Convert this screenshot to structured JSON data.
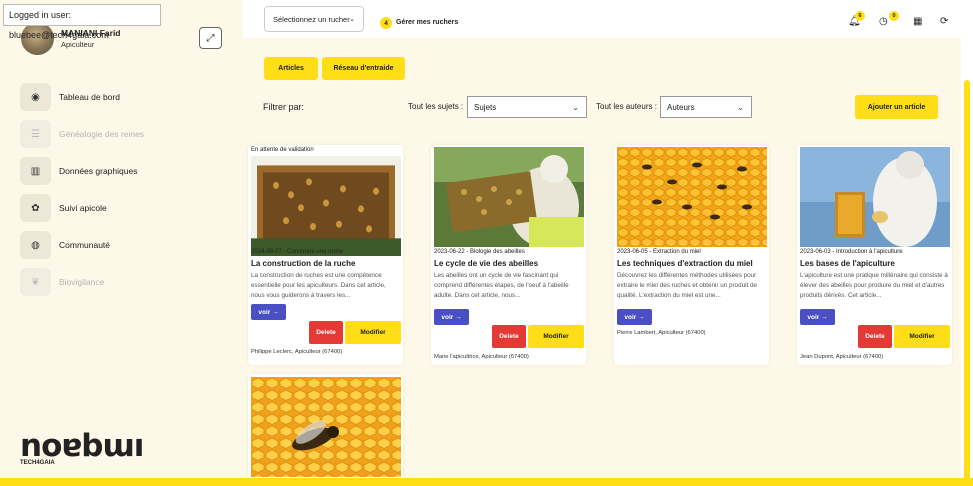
{
  "login_banner": "Logged in user: bluebee@tech4gaia.com",
  "user": {
    "name": "MANIANI Farid",
    "role": "Apiculteur"
  },
  "sidebar": {
    "items": [
      {
        "label": "Tableau de bord",
        "icon": "dashboard-icon",
        "glyph": "◉",
        "enabled": true
      },
      {
        "label": "Généalogie des reines",
        "icon": "list-icon",
        "glyph": "☰",
        "enabled": false
      },
      {
        "label": "Données graphiques",
        "icon": "bar-chart-icon",
        "glyph": "▥",
        "enabled": true
      },
      {
        "label": "Suivi apicole",
        "icon": "bee-icon",
        "glyph": "✿",
        "enabled": true
      },
      {
        "label": "Communauté",
        "icon": "globe-icon",
        "glyph": "◍",
        "enabled": true
      },
      {
        "label": "Biovigilance",
        "icon": "sprout-icon",
        "glyph": "❦",
        "enabled": false
      }
    ]
  },
  "logo": {
    "mark": "noɐbɯı",
    "sub": "TECH4GAIA"
  },
  "topbar": {
    "hive_select": "Sélectionnez un rucher",
    "hive_count": "4",
    "manage_hives": "Gérer mes ruchers",
    "notifications_count": "6",
    "clock_count": "0"
  },
  "tabs": {
    "articles": "Articles",
    "network": "Réseau d'entraide"
  },
  "filters": {
    "label": "Filtrer par:",
    "subjects_label": "Tout les sujets :",
    "subjects_value": "Sujets",
    "authors_label": "Tout les auteurs :",
    "authors_value": "Auteurs",
    "add_article": "Ajouter un article"
  },
  "card_labels": {
    "voir": "voir",
    "delete": "Delete",
    "modify": "Modifier"
  },
  "articles": [
    {
      "status": "En attente de validation",
      "meta": "2024-08-07 - Construire une ruche",
      "title": "La construction de la ruche",
      "excerpt": "La construction de ruches est une compétence essentielle pour les apiculteurs. Dans cet article, nous vous guiderons à travers les...",
      "author": "Philippe Leclerc, Apiculteur (67400)"
    },
    {
      "status": "",
      "meta": "2023-06-22 - Biologie des abeilles",
      "title": "Le cycle de vie des abeilles",
      "excerpt": "Les abeilles ont un cycle de vie fascinant qui comprend différentes étapes, de l'oeuf à l'abeille adulte. Dans cet article, nous...",
      "author": "Marie l'apicultrice, Apiculteur (67400)"
    },
    {
      "status": "",
      "meta": "2023-06-05 - Extraction du miel",
      "title": "Les techniques d'extraction du miel",
      "excerpt": "Découvrez les différentes méthodes utilisées pour extraire le miel des ruches et obtenir un produit de qualité. L'extraction du miel est une...",
      "author": "Pierre Lambert, Apiculteur (67400)"
    },
    {
      "status": "",
      "meta": "2023-06-03 - Introduction à l'apiculture",
      "title": "Les bases de l'apiculture",
      "excerpt": "L'apiculture est une pratique millénaire qui consiste à élever des abeilles pour produire du miel et d'autres produits dérivés. Cet article...",
      "author": "Jean Dupont, Apiculteur (67400)"
    }
  ]
}
